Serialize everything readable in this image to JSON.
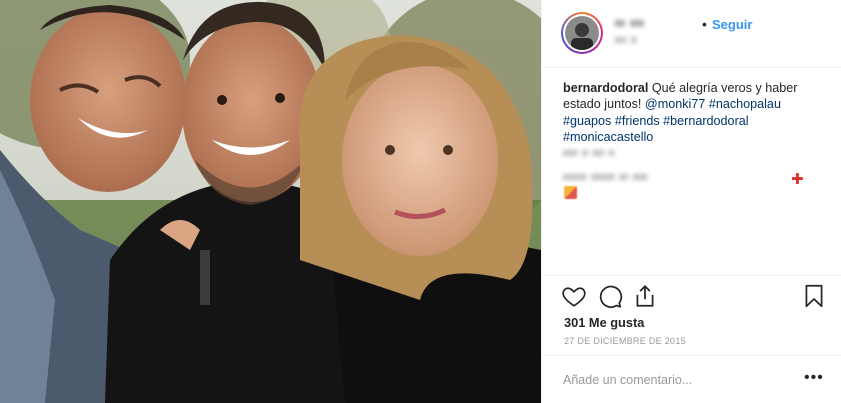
{
  "post": {
    "author_username": "ᴵᴵᴵ ᴵᴵᴵᴵ",
    "follow_label": "Seguir",
    "location": "ᴵᴵᴵᴵ ᴵᴵ",
    "separator": "•"
  },
  "caption": {
    "username": "bernardodoral",
    "text": "Qué alegría veros y haber estado juntos!",
    "tags": [
      "@monki77",
      "#nachopalau",
      "#guapos",
      "#friends",
      "#bernardodoral",
      "#monicacastello"
    ]
  },
  "comments": [
    {
      "blurred_text": "ᴵᴵᴵᴵᴵ ᴵᴵ ᴵᴵᴵᴵ ᴵᴵ"
    },
    {
      "blurred_text": "ᴵᴵᴵᴵᴵᴵᴵᴵ ᴵᴵᴵᴵᴵᴵᴵᴵ ᴵᴵᴵ ᴵᴵᴵᴵᴵ"
    }
  ],
  "actions": {
    "icons": [
      "heart-icon",
      "comment-icon",
      "share-icon",
      "bookmark-icon"
    ]
  },
  "likes_label": "301 Me gusta",
  "date_label": "27 DE DICIEMBRE DE 2015",
  "comment_box": {
    "placeholder": "Añade un comentario...",
    "more_label": "•••"
  },
  "colors": {
    "link": "#003569",
    "follow": "#3897f0",
    "muted": "#999999",
    "border": "#efefef"
  }
}
